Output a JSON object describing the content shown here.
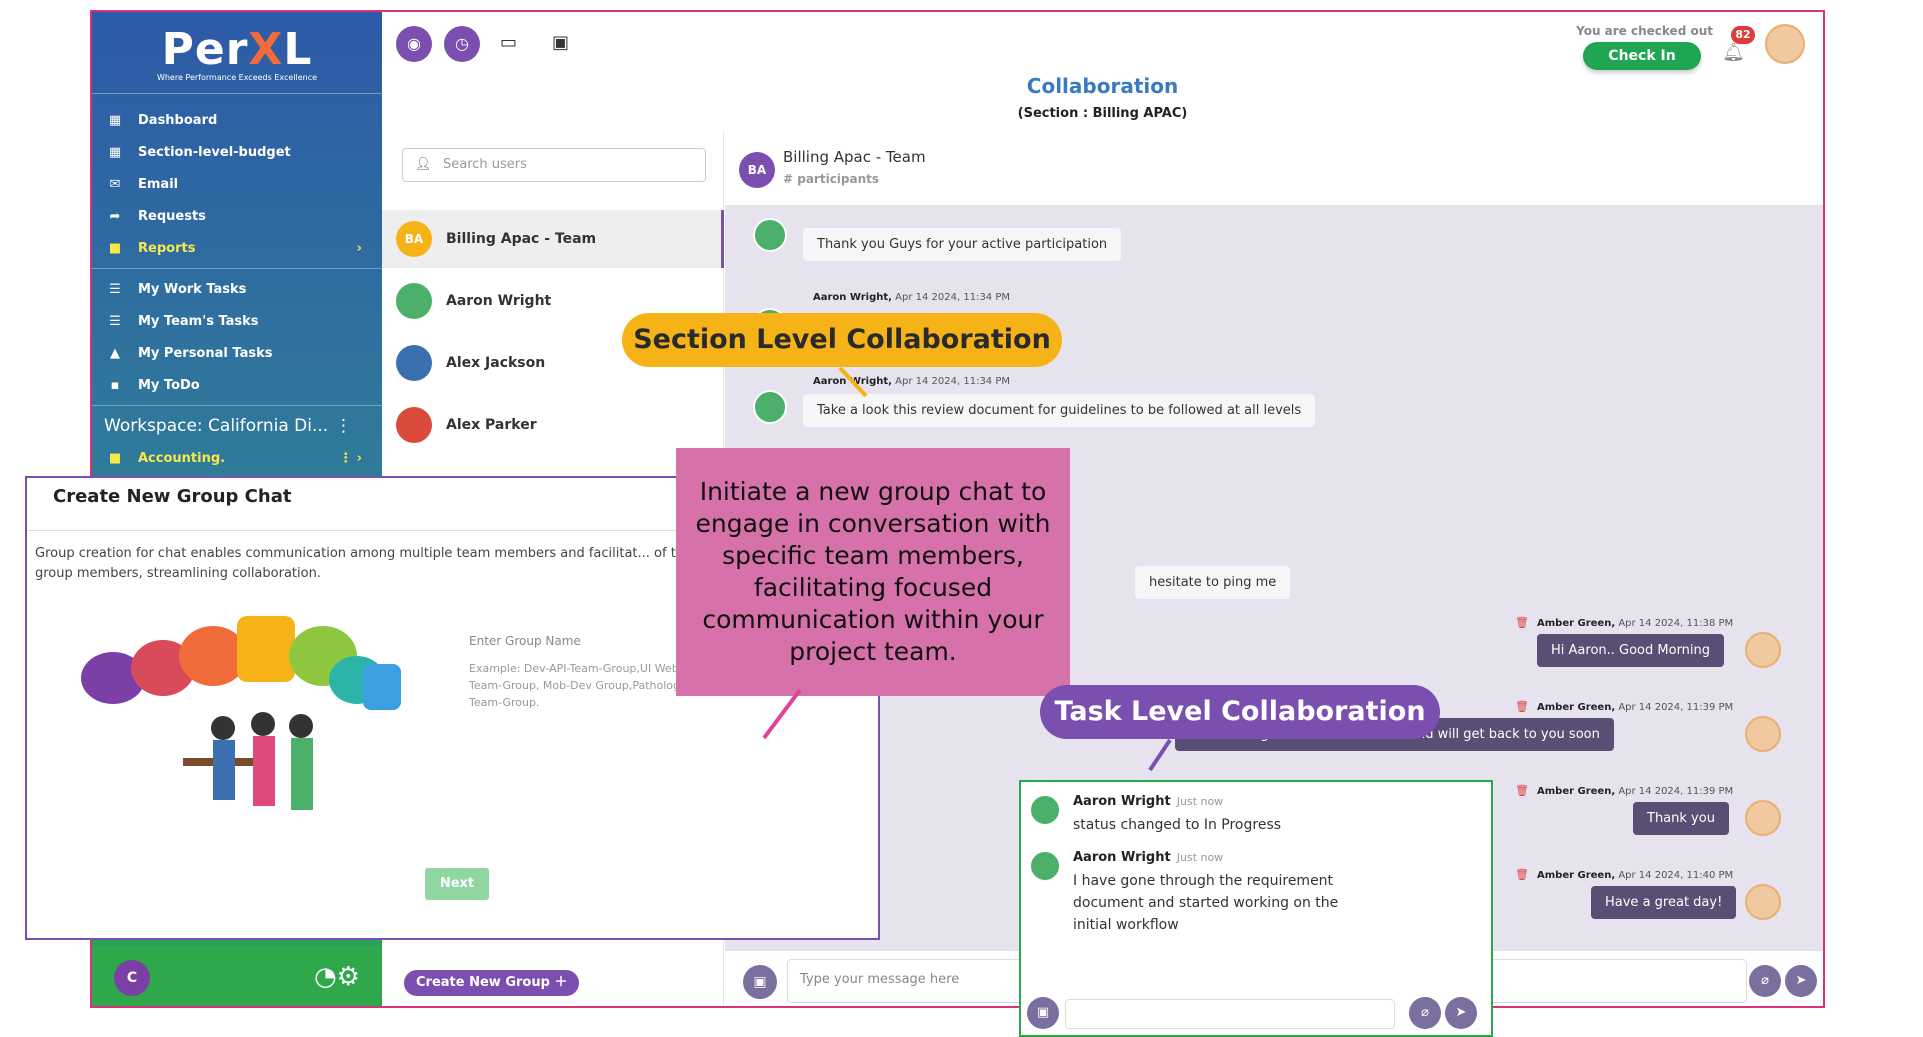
{
  "logo": {
    "brand_left": "Per",
    "brand_x": "X",
    "brand_right": "L",
    "tagline": "Where Performance Exceeds Excellence"
  },
  "sidebar": {
    "items": [
      {
        "label": "Dashboard",
        "icon": "grid-icon"
      },
      {
        "label": "Section-level-budget",
        "icon": "grid-icon"
      },
      {
        "label": "Email",
        "icon": "mail-icon"
      },
      {
        "label": "Requests",
        "icon": "share-icon"
      },
      {
        "label": "Reports",
        "icon": "folder-icon"
      }
    ],
    "tasks": [
      {
        "label": "My Work Tasks",
        "icon": "list-icon"
      },
      {
        "label": "My Team's Tasks",
        "icon": "list-icon"
      },
      {
        "label": "My Personal Tasks",
        "icon": "lock-icon"
      },
      {
        "label": "My ToDo",
        "icon": "note-icon"
      }
    ],
    "workspace": "Workspace: California Di...",
    "workspace_folder": "Accounting.",
    "user_initial": "C"
  },
  "header": {
    "title": "Collaboration",
    "subtitle": "(Section : Billing APAC)",
    "checked_out": "You are checked out",
    "check_in": "Check In",
    "notifications": "82"
  },
  "userlist": {
    "search_placeholder": "Search users",
    "users": [
      {
        "initials": "BA",
        "name": "Billing Apac - Team"
      },
      {
        "initials": "",
        "name": "Aaron Wright"
      },
      {
        "initials": "",
        "name": "Alex Jackson"
      },
      {
        "initials": "",
        "name": "Alex Parker"
      }
    ],
    "create_group": "Create New Group"
  },
  "chat": {
    "team_initials": "BA",
    "team_name": "Billing Apac - Team",
    "participants": "# participants",
    "messages_left": [
      {
        "text": "Thank you Guys for your active participation"
      },
      {
        "author": "Aaron Wright,",
        "time": "Apr 14 2024, 11:34 PM",
        "text": ""
      },
      {
        "author": "Aaron Wright,",
        "time": "Apr 14 2024, 11:34 PM",
        "text": "Take a look this review document for guidelines to be followed at all levels"
      },
      {
        "text": "hesitate to ping me"
      }
    ],
    "messages_right": [
      {
        "author": "Amber Green,",
        "time": "Apr 14 2024, 11:38 PM",
        "text": "Hi Aaron.. Good Morning"
      },
      {
        "author": "Amber Green,",
        "time": "Apr 14 2024, 11:39 PM",
        "text": "Sure. I will go over the document and will get back to you soon"
      },
      {
        "author": "Amber Green,",
        "time": "Apr 14 2024, 11:39 PM",
        "text": "Thank you"
      },
      {
        "author": "Amber Green,",
        "time": "Apr 14 2024, 11:40 PM",
        "text": "Have a great day!"
      }
    ],
    "compose_placeholder": "Type your message here"
  },
  "modal": {
    "title": "Create New Group Chat",
    "description": "Group creation for chat enables communication among multiple team members and facilitat... of task-related files to all group members, streamlining collaboration.",
    "group_name_placeholder": "Enter Group Name",
    "example": "Example: Dev-API-Team-Group,UI Web-Dev-Team-Group, Mob-Dev Group,Pathology-Team-Group.",
    "next": "Next"
  },
  "callouts": {
    "section": "Section Level Collaboration",
    "task": "Task Level Collaboration",
    "group": "Initiate a new group chat to engage in conversation with specific team members, facilitating focused communication within your project team."
  },
  "task_chat": {
    "messages": [
      {
        "author": "Aaron Wright",
        "time": "Just now",
        "text": "status changed to In Progress"
      },
      {
        "author": "Aaron Wright",
        "time": "Just now",
        "text": "I have gone through the requirement document and started working on the initial workflow"
      }
    ]
  },
  "colors": {
    "accent": "#7b4fb0",
    "check_in": "#1fa653",
    "callout_orange": "#f5b318",
    "callout_pink": "#d671a9"
  }
}
